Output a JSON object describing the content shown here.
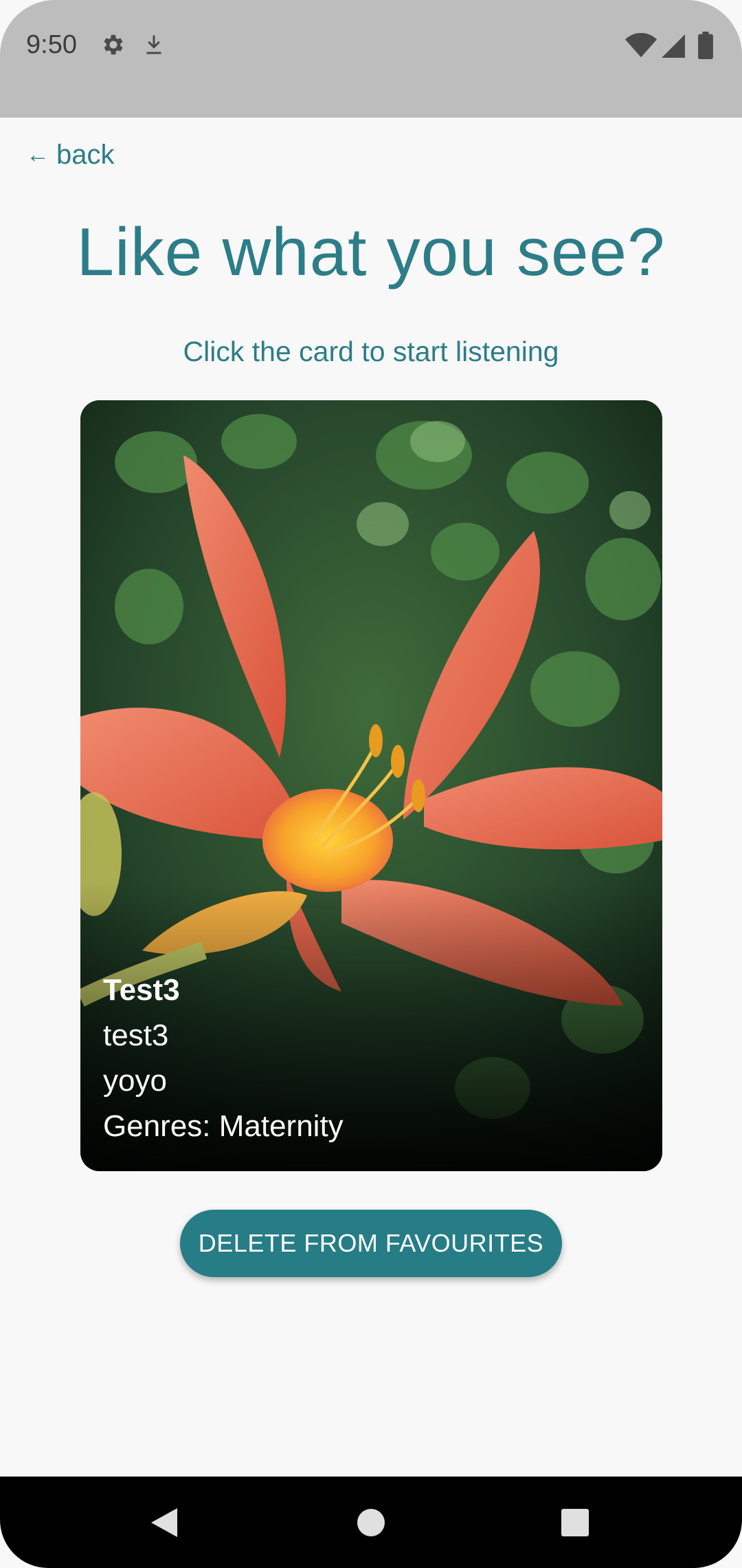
{
  "status_bar": {
    "time": "9:50",
    "icons": [
      "gear-icon",
      "download-icon",
      "wifi-icon",
      "signal-icon",
      "battery-icon"
    ]
  },
  "nav": {
    "back_label": "back",
    "back_icon": "left-arrow-icon"
  },
  "header": {
    "title": "Like what you see?",
    "subtitle": "Click the card to start listening"
  },
  "card": {
    "title": "Test3",
    "line1": "test3",
    "line2": "yoyo",
    "genres": "Genres: Maternity",
    "image": "orange-lily-flower-photo"
  },
  "actions": {
    "delete_label": "DELETE FROM FAVOURITES"
  },
  "system_nav": {
    "buttons": [
      "back-triangle-icon",
      "home-circle-icon",
      "recents-square-icon"
    ]
  },
  "colors": {
    "accent": "#2c7d87",
    "button": "#267d86",
    "background": "#f8f8f8"
  }
}
